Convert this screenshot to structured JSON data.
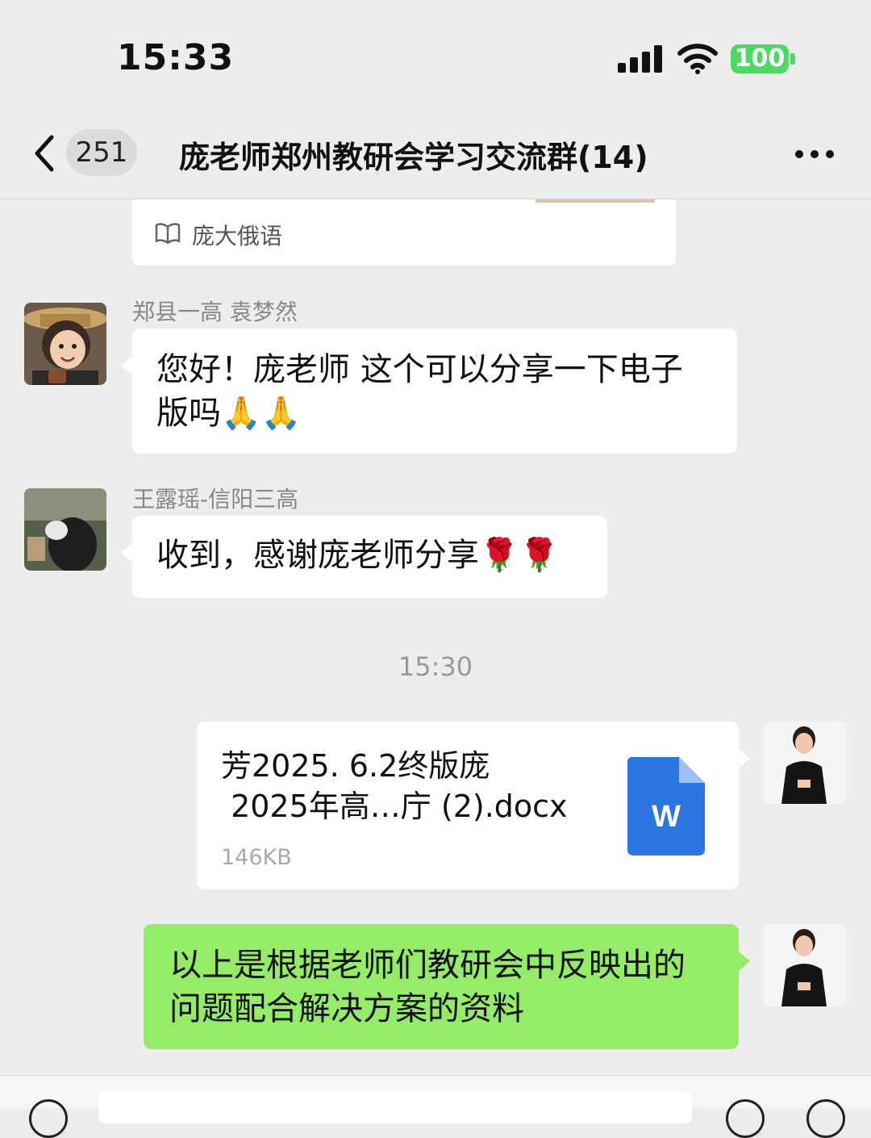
{
  "status_bar": {
    "time": "15:33",
    "battery": "100"
  },
  "nav": {
    "unread_count": "251",
    "title": "庞老师郑州教研会学习交流群(14)"
  },
  "shared_card": {
    "source_label": "庞大俄语"
  },
  "messages": [
    {
      "sender": "郑县一高 袁梦然",
      "text": "您好！庞老师 这个可以分享一下电子版吗🙏🙏"
    },
    {
      "sender": "王露瑶-信阳三高",
      "text": "收到，感谢庞老师分享🌹🌹"
    }
  ],
  "timestamp": "15:30",
  "file_message": {
    "name_line1": "芳2025. 6.2终版庞",
    "name_line2": " 2025年高…庁 (2).docx",
    "size": "146KB",
    "icon_letter": "W"
  },
  "own_text_message": "以上是根据老师们教研会中反映出的问题配合解决方案的资料",
  "colors": {
    "background": "#ededed",
    "own_bubble": "#95ec69",
    "word_blue": "#2b75e1",
    "battery_green": "#4cd964"
  },
  "icons": [
    "back-chevron-icon",
    "more-icon",
    "book-icon",
    "word-doc-icon",
    "signal-icon",
    "wifi-icon"
  ]
}
